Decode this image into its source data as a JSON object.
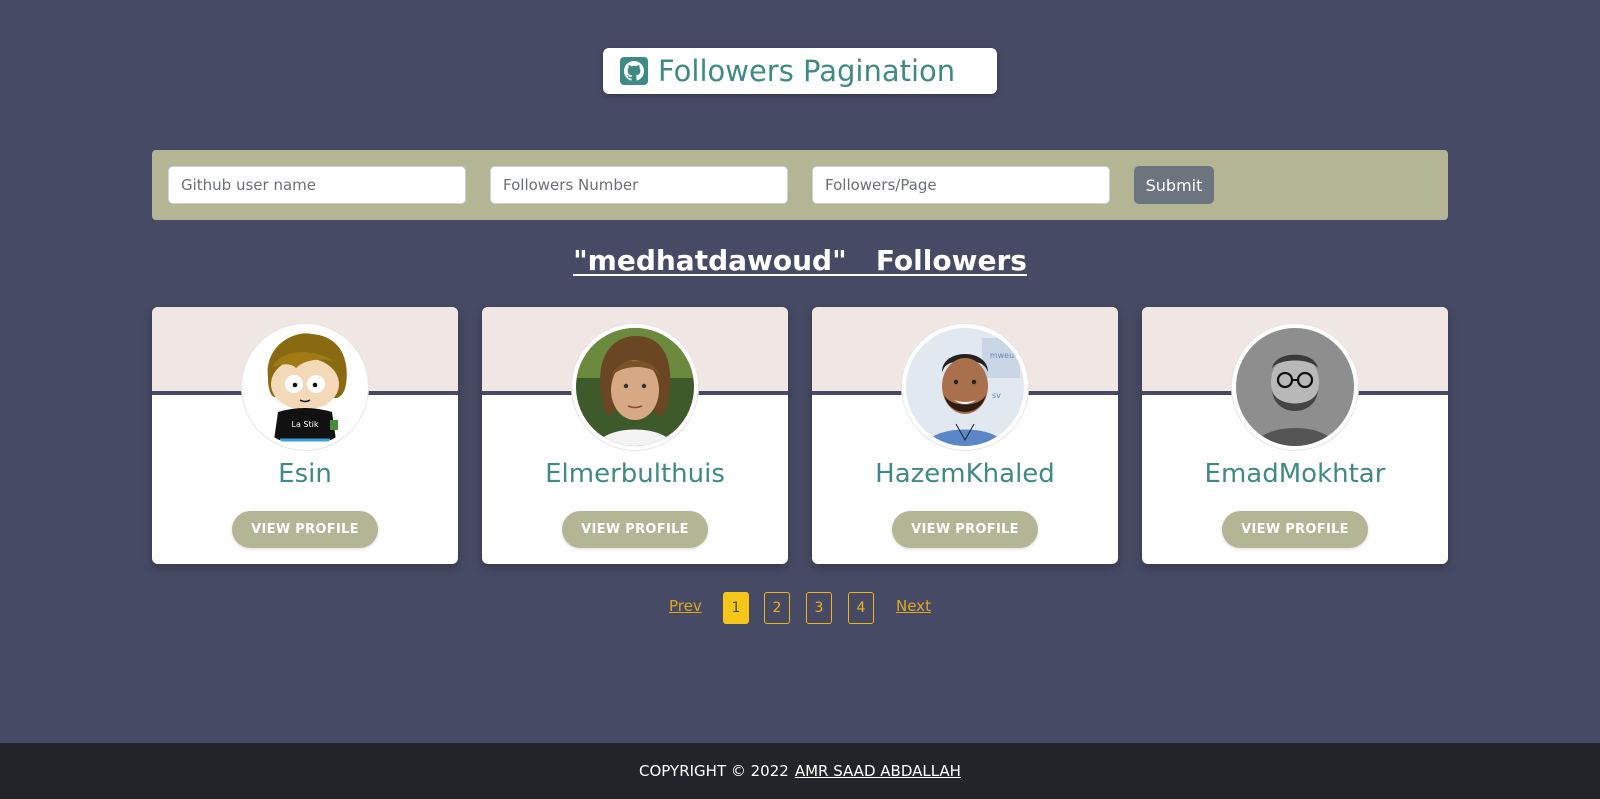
{
  "header": {
    "title": "Followers Pagination",
    "icon": "github-icon"
  },
  "form": {
    "username_placeholder": "Github user name",
    "followers_number_placeholder": "Followers Number",
    "followers_per_page_placeholder": "Followers/Page",
    "submit_label": "Submit"
  },
  "followers_heading": "\"medhatdawoud\"   Followers",
  "cards": [
    {
      "name": "Esin",
      "button": "VIEW PROFILE",
      "avatar": "cartoon-avatar-icon"
    },
    {
      "name": "Elmerbulthuis",
      "button": "VIEW PROFILE",
      "avatar": "portrait-avatar-icon"
    },
    {
      "name": "HazemKhaled",
      "button": "VIEW PROFILE",
      "avatar": "portrait-avatar-icon"
    },
    {
      "name": "EmadMokhtar",
      "button": "VIEW PROFILE",
      "avatar": "portrait-avatar-icon"
    }
  ],
  "pagination": {
    "prev": "Prev",
    "pages": [
      "1",
      "2",
      "3",
      "4"
    ],
    "active_page": "1",
    "next": "Next"
  },
  "footer": {
    "copyright": "COPYRIGHT © 2022",
    "author": "AMR SAAD ABDALLAH"
  },
  "colors": {
    "background": "#474a64",
    "accent_teal": "#3f8a84",
    "olive": "#b3b595",
    "pagination_gold": "#f0b31c",
    "footer": "#212529"
  }
}
